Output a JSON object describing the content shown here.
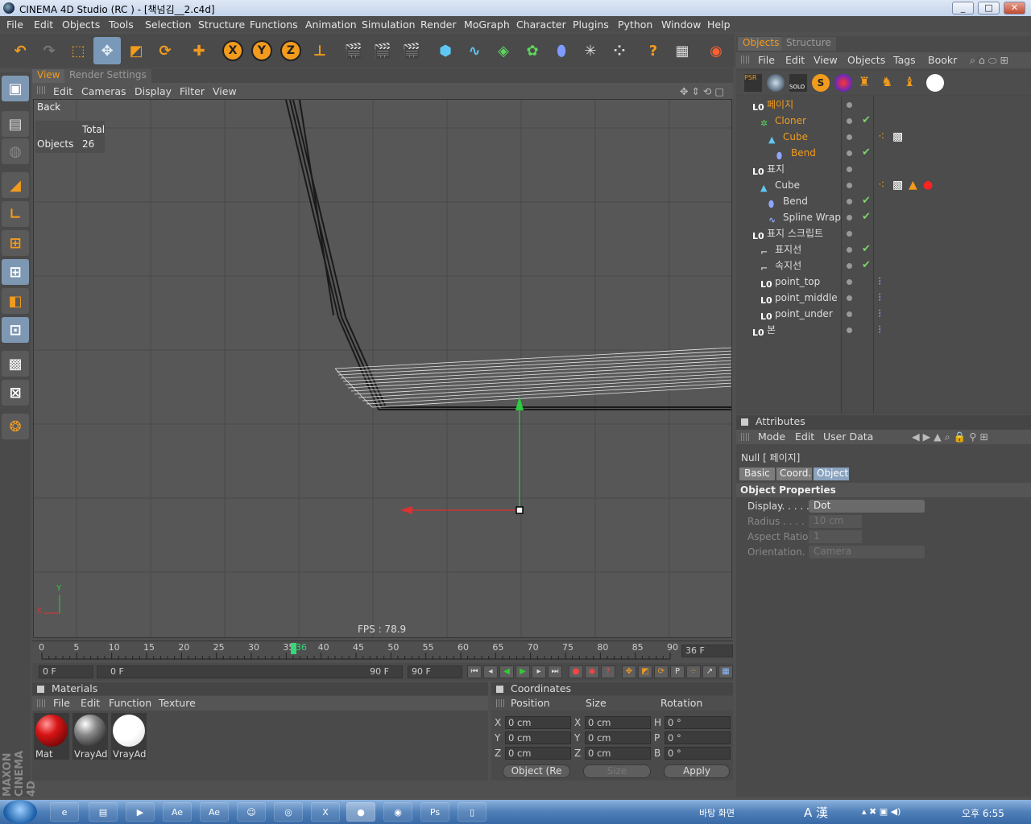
{
  "window": {
    "title": "CINEMA 4D Studio (RC ) - [책넘김__2.c4d]",
    "min": "_",
    "max": "□",
    "close": "✕"
  },
  "menubar": [
    "File",
    "Edit",
    "Objects",
    "Tools",
    "Selection",
    "Structure",
    "Functions",
    "Animation",
    "Simulation",
    "Render",
    "MoGraph",
    "Character",
    "Plugins",
    "Python",
    "Window",
    "Help"
  ],
  "viewport": {
    "tabs": [
      "View",
      "Render Settings"
    ],
    "menu": [
      "Edit",
      "Cameras",
      "Display",
      "Filter",
      "View"
    ],
    "camera": "Back",
    "stats_header": "Total",
    "stats_label": "Objects",
    "stats_value": "26",
    "fps": "FPS : 78.9",
    "axis_y": "Y",
    "axis_x": "X"
  },
  "timeline": {
    "ticks": [
      "0",
      "5",
      "10",
      "15",
      "20",
      "25",
      "30",
      "35",
      "36",
      "40",
      "45",
      "50",
      "55",
      "60",
      "65",
      "70",
      "75",
      "80",
      "85",
      "90"
    ],
    "current_frame": "36 F",
    "start": "0 F",
    "range_start": "0 F",
    "range_end": "90 F",
    "end": "90 F"
  },
  "materials": {
    "title": "Materials",
    "menu": [
      "File",
      "Edit",
      "Function",
      "Texture"
    ],
    "items": [
      {
        "name": "Mat",
        "color": "#d81515"
      },
      {
        "name": "VrayAd",
        "color": "#8a8a8a"
      },
      {
        "name": "VrayAd",
        "color": "#ffffff"
      }
    ]
  },
  "coordinates": {
    "title": "Coordinates",
    "headers": [
      "Position",
      "Size",
      "Rotation"
    ],
    "pos_labels": [
      "X",
      "Y",
      "Z"
    ],
    "pos_values": [
      "0 cm",
      "0 cm",
      "0 cm"
    ],
    "size_labels": [
      "X",
      "Y",
      "Z"
    ],
    "size_values": [
      "0 cm",
      "0 cm",
      "0 cm"
    ],
    "rot_labels": [
      "H",
      "P",
      "B"
    ],
    "rot_values": [
      "0 °",
      "0 °",
      "0 °"
    ],
    "mode": "Object (Re",
    "size_mode": "Size",
    "apply": "Apply"
  },
  "objects": {
    "tabs": [
      "Objects",
      "Structure"
    ],
    "menu": [
      "File",
      "Edit",
      "View",
      "Objects",
      "Tags",
      "Bookr"
    ],
    "tree": [
      {
        "name": "페이지",
        "icon": "null-icon",
        "highlight": true
      },
      {
        "name": "Cloner",
        "icon": "cloner-icon",
        "highlight": true
      },
      {
        "name": "Cube",
        "icon": "cube-icon",
        "highlight": true
      },
      {
        "name": "Bend",
        "icon": "bend-icon",
        "highlight": true
      },
      {
        "name": "표지",
        "icon": "null-icon",
        "highlight": false
      },
      {
        "name": "Cube",
        "icon": "cube-icon",
        "highlight": false
      },
      {
        "name": "Bend",
        "icon": "bend-icon",
        "highlight": false
      },
      {
        "name": "Spline Wrap",
        "icon": "spline-wrap-icon",
        "highlight": false
      },
      {
        "name": "표지 스크립트",
        "icon": "null-icon",
        "highlight": false
      },
      {
        "name": "표지선",
        "icon": "spline-icon",
        "highlight": false
      },
      {
        "name": "속지선",
        "icon": "spline-icon",
        "highlight": false
      },
      {
        "name": "point_top",
        "icon": "null-icon",
        "highlight": false
      },
      {
        "name": "point_middle",
        "icon": "null-icon",
        "highlight": false
      },
      {
        "name": "point_under",
        "icon": "null-icon",
        "highlight": false
      },
      {
        "name": "본",
        "icon": "null-icon",
        "highlight": false
      }
    ]
  },
  "attributes": {
    "title": "Attributes",
    "menu": [
      "Mode",
      "Edit",
      "User Data"
    ],
    "object_name": "Null [ 페이지]",
    "tabs": [
      "Basic",
      "Coord.",
      "Object"
    ],
    "section": "Object Properties",
    "props": [
      {
        "label": "Display. . . . .",
        "value": "Dot"
      },
      {
        "label": "Radius . . . . .",
        "value": "10 cm"
      },
      {
        "label": "Aspect Ratio",
        "value": "1"
      },
      {
        "label": "Orientation. .",
        "value": "Camera"
      }
    ]
  },
  "taskbar": {
    "ime": "바탕 화면",
    "clock": "오후 6:55",
    "lang": "A 漢"
  },
  "colors": {
    "accent": "#f29b1d",
    "selection": "#7e98b3",
    "panel": "#4a4a4a"
  }
}
